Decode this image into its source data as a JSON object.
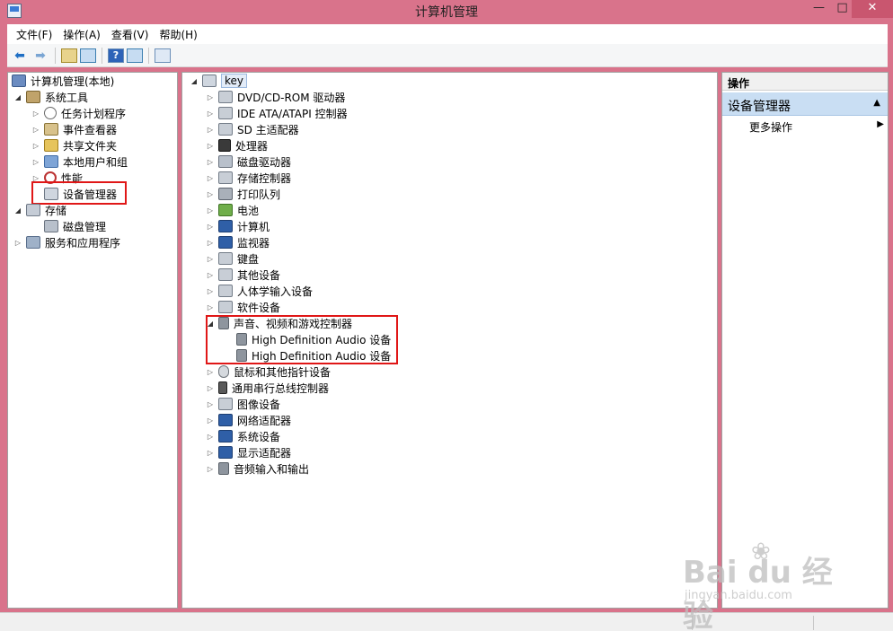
{
  "window": {
    "title": "计算机管理",
    "controls": {
      "minimize": "—",
      "maximize": "□",
      "close": "✕"
    }
  },
  "menu": [
    "文件(F)",
    "操作(A)",
    "查看(V)",
    "帮助(H)"
  ],
  "left_tree": {
    "root": "计算机管理(本地)",
    "items": [
      {
        "label": "系统工具",
        "icon": "tools-icon"
      },
      {
        "label": "任务计划程序",
        "icon": "clock-icon"
      },
      {
        "label": "事件查看器",
        "icon": "event-viewer-icon"
      },
      {
        "label": "共享文件夹",
        "icon": "shared-folder-icon"
      },
      {
        "label": "本地用户和组",
        "icon": "users-icon"
      },
      {
        "label": "性能",
        "icon": "performance-icon"
      },
      {
        "label": "设备管理器",
        "icon": "device-manager-icon"
      },
      {
        "label": "存储",
        "icon": "storage-icon"
      },
      {
        "label": "磁盘管理",
        "icon": "disk-management-icon"
      },
      {
        "label": "服务和应用程序",
        "icon": "services-icon"
      }
    ]
  },
  "device_tree": {
    "root": "key",
    "categories": [
      "DVD/CD-ROM 驱动器",
      "IDE ATA/ATAPI 控制器",
      "SD 主适配器",
      "处理器",
      "磁盘驱动器",
      "存储控制器",
      "打印队列",
      "电池",
      "计算机",
      "监视器",
      "键盘",
      "其他设备",
      "人体学输入设备",
      "软件设备",
      "声音、视频和游戏控制器",
      "High Definition Audio 设备",
      "High Definition Audio 设备",
      "鼠标和其他指针设备",
      "通用串行总线控制器",
      "图像设备",
      "网络适配器",
      "系统设备",
      "显示适配器",
      "音频输入和输出"
    ]
  },
  "actions": {
    "header": "操作",
    "section": "设备管理器",
    "more": "更多操作"
  },
  "watermark": {
    "main": "Bai du 经验",
    "sub": "jingyan.baidu.com"
  },
  "colors": {
    "titlebar": "#d9738b",
    "highlight_box": "#e01717",
    "actions_section": "#c9def3"
  }
}
